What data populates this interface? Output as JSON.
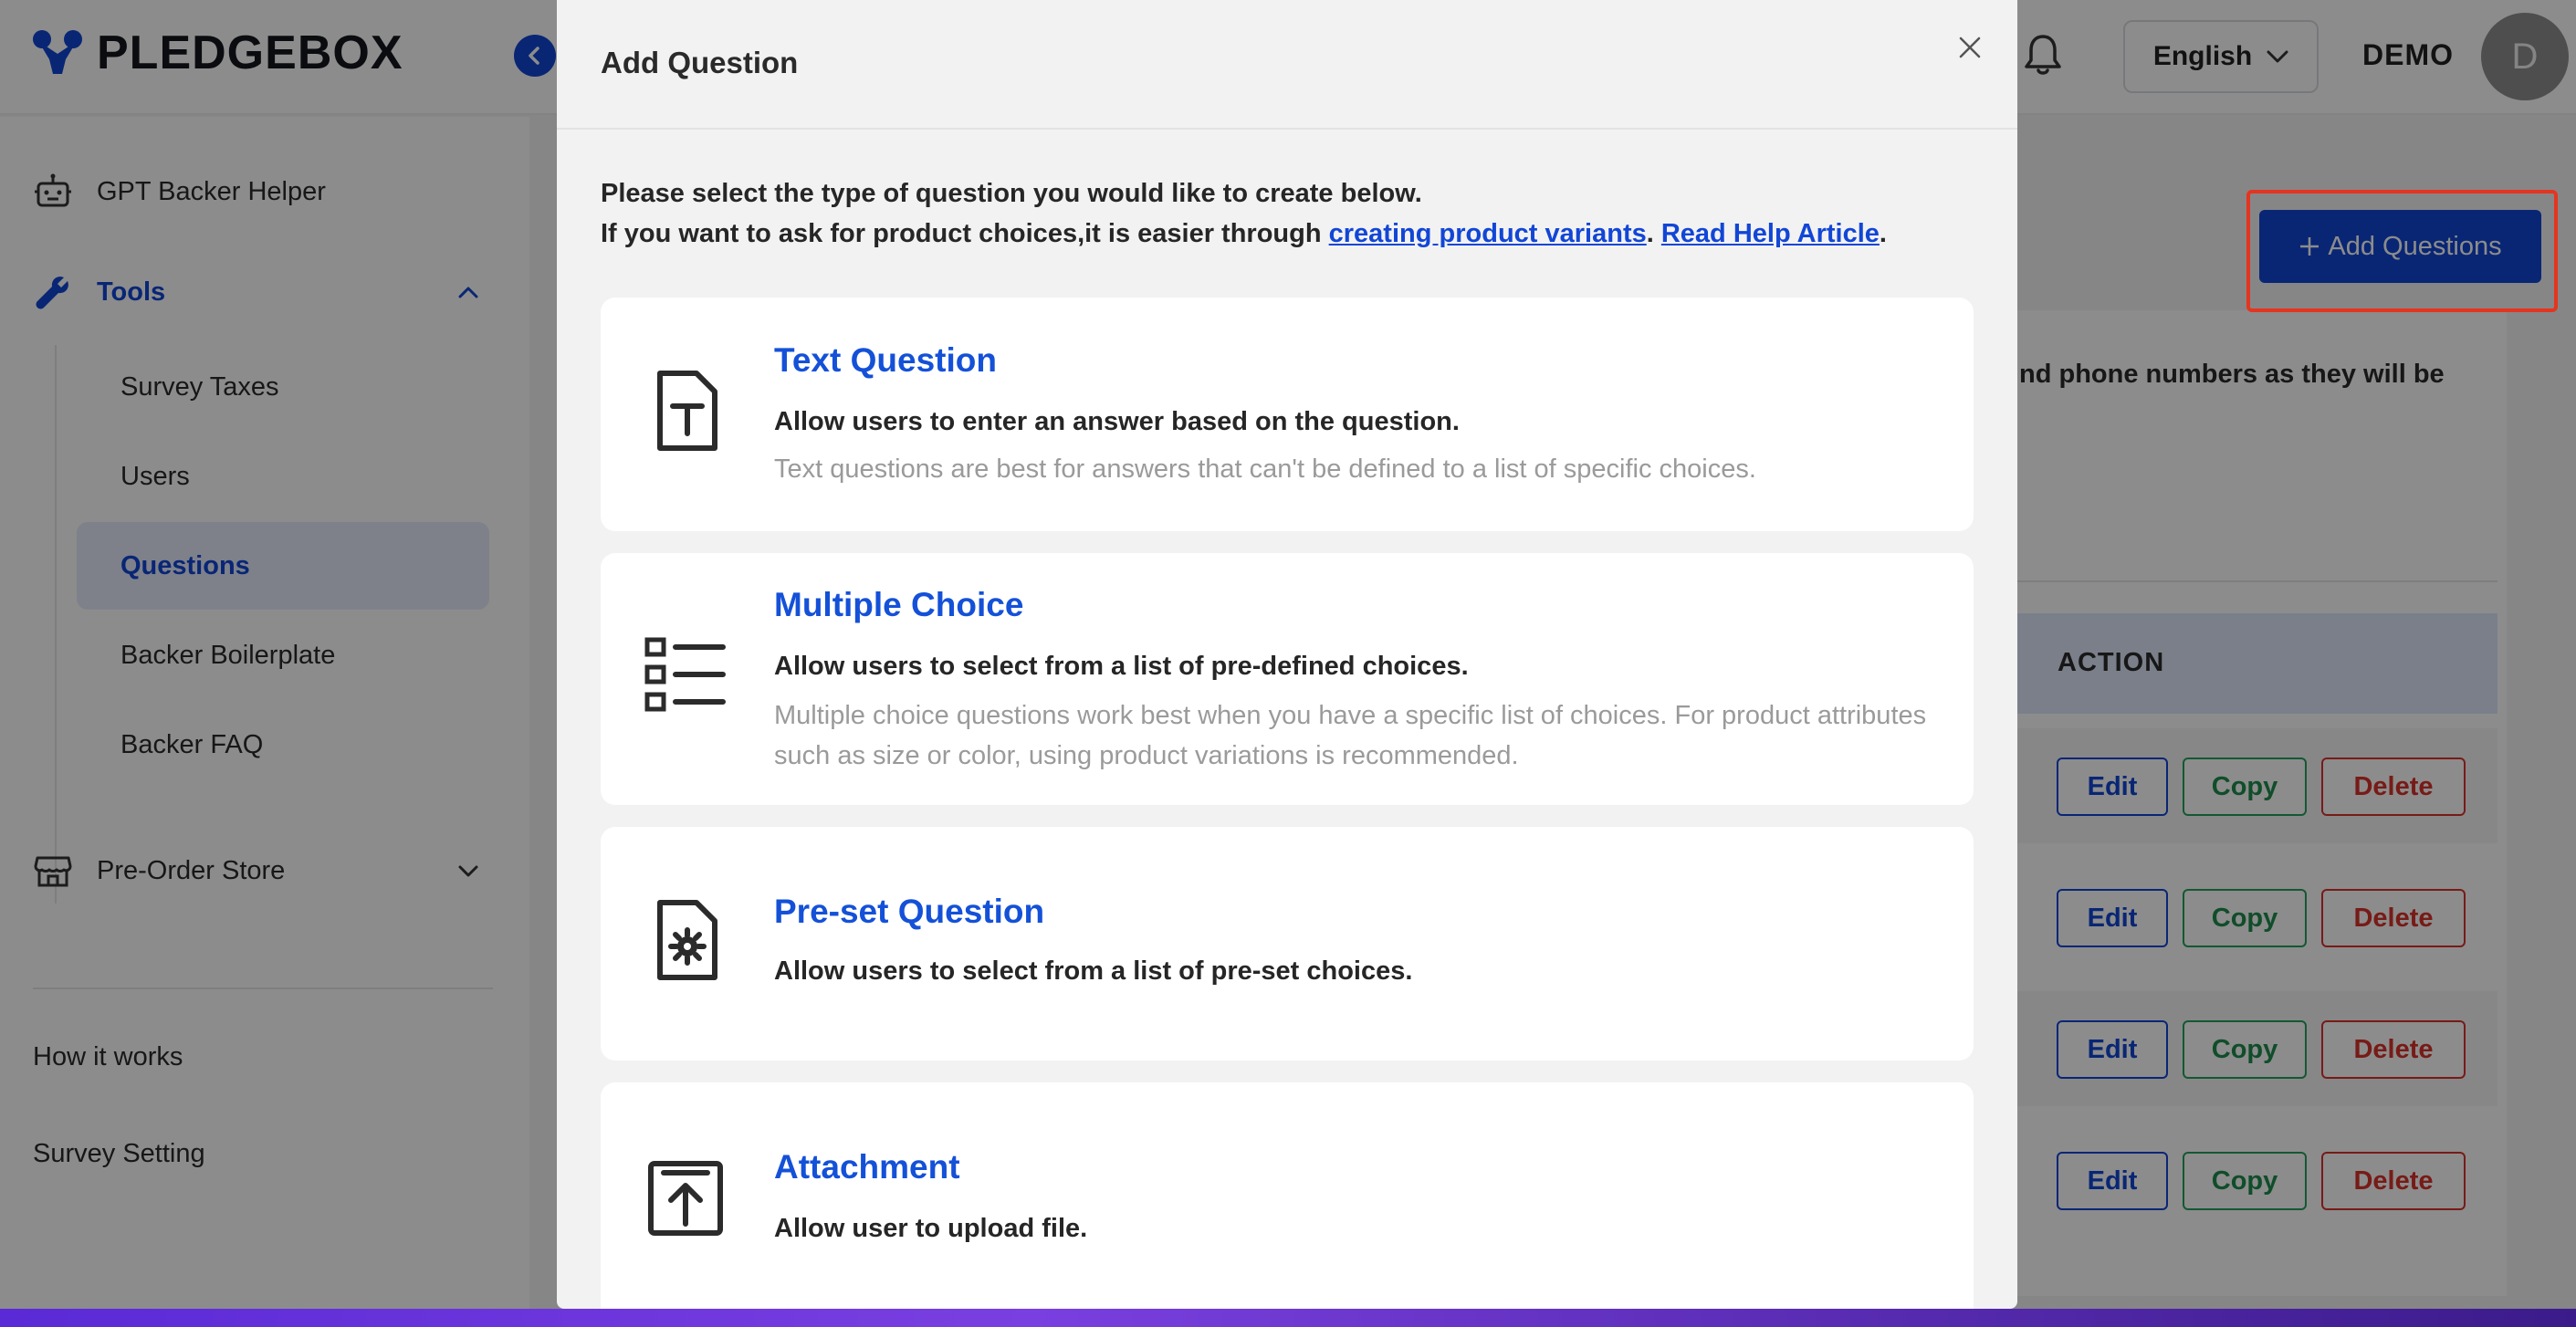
{
  "app": {
    "brand": "PLEDGEBOX",
    "language": "English",
    "user_label": "DEMO",
    "avatar_initial": "D",
    "add_questions_label": "Add Questions",
    "background_note": "nd phone numbers as they will be",
    "table_action_header": "ACTION"
  },
  "sidebar": {
    "gpt_helper": "GPT Backer Helper",
    "tools": "Tools",
    "sub_items": [
      "Survey Taxes",
      "Users",
      "Questions",
      "Backer Boilerplate",
      "Backer FAQ"
    ],
    "pre_order": "Pre-Order Store",
    "how_it_works": "How it works",
    "survey_setting": "Survey Setting"
  },
  "rows": {
    "edit": "Edit",
    "copy": "Copy",
    "delete": "Delete"
  },
  "modal": {
    "title": "Add Question",
    "intro_line1": "Please select the type of question you would like to create below.",
    "intro_line2_prefix": "If you want to ask for product choices,it is easier through ",
    "intro_link1": "creating product variants",
    "intro_sep": ". ",
    "intro_link2": "Read Help Article",
    "intro_end": ".",
    "cards": [
      {
        "icon": "text-document-icon",
        "title": "Text Question",
        "subtitle": "Allow users to enter an answer based on the question.",
        "description": "Text questions are best for answers that can't be defined to a list of specific choices."
      },
      {
        "icon": "list-icon",
        "title": "Multiple Choice",
        "subtitle": "Allow users to select from a list of pre-defined choices.",
        "description": "Multiple choice questions work best when you have a specific list of choices. For product attributes such as size or color, using product variations is recommended."
      },
      {
        "icon": "gear-document-icon",
        "title": "Pre-set Question",
        "subtitle": "Allow users to select from a list of pre-set choices."
      },
      {
        "icon": "upload-icon",
        "title": "Attachment",
        "subtitle": "Allow user to upload file."
      }
    ]
  },
  "colors": {
    "accent": "#1146d6",
    "highlight": "#e5341f",
    "copy_green": "#1f8d4e",
    "delete_red": "#d9322a"
  }
}
